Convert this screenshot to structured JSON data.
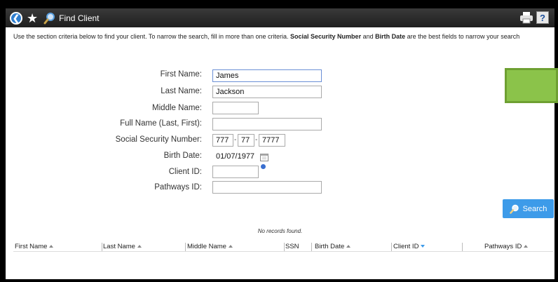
{
  "titlebar": {
    "title": "Find Client",
    "back_icon": "back-arrow-icon",
    "star_icon": "star-icon",
    "search_icon": "search-icon",
    "print_icon": "print-icon",
    "help_label": "?"
  },
  "intro": {
    "part1": "Use the section criteria below to find your client. To narrow the search, fill in more than one criteria. ",
    "bold1": "Social Security Number",
    "part2": " and ",
    "bold2": "Birth Date",
    "part3": " are the best fields to narrow your search"
  },
  "form": {
    "first_name_label": "First Name:",
    "first_name_value": "James",
    "last_name_label": "Last Name:",
    "last_name_value": "Jackson",
    "middle_name_label": "Middle Name:",
    "middle_name_value": "",
    "full_name_label": "Full Name (Last, First):",
    "full_name_value": "",
    "ssn_label": "Social Security Number:",
    "ssn_1": "777",
    "ssn_2": "77",
    "ssn_3": "7777",
    "dash": "-",
    "birth_date_label": "Birth Date:",
    "birth_date_value": "01/07/1977",
    "client_id_label": "Client ID:",
    "client_id_value": "",
    "pathways_id_label": "Pathways ID:",
    "pathways_id_value": ""
  },
  "search_button": {
    "label": "Search"
  },
  "results": {
    "empty_message": "No records found.",
    "columns": [
      "First Name",
      "Last Name",
      "Middle Name",
      "SSN",
      "Birth Date",
      "Client ID",
      "Pathways ID"
    ]
  },
  "colors": {
    "accent": "#3d9be9",
    "green_box": "#8bc34a",
    "titlebar": "#2a2a2a"
  }
}
